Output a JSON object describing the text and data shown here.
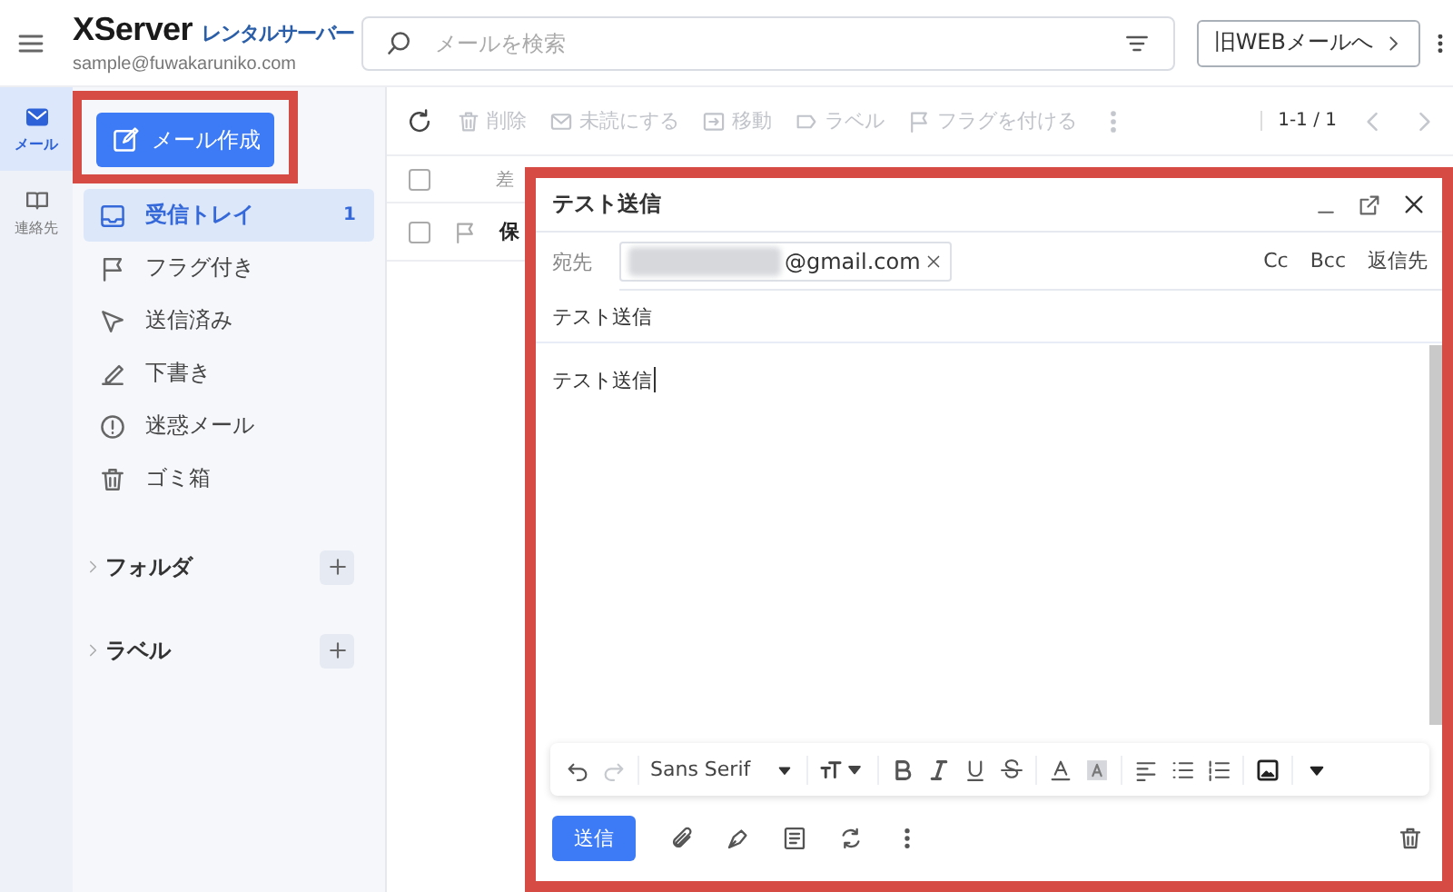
{
  "header": {
    "logo_brand": "XServer",
    "logo_sub": "レンタルサーバー",
    "account": "sample@fuwakaruniko.com",
    "search": {
      "placeholder": "メールを検索"
    },
    "legacy_button": "旧WEBメールへ"
  },
  "rail": [
    {
      "label": "メール",
      "kind": "mail",
      "selected": true
    },
    {
      "label": "連絡先",
      "kind": "contacts",
      "selected": false
    }
  ],
  "compose_button": "メール作成",
  "folders": [
    {
      "label": "受信トレイ",
      "kind": "inbox",
      "selected": true,
      "count": "1"
    },
    {
      "label": "フラグ付き",
      "kind": "flagged",
      "selected": false
    },
    {
      "label": "送信済み",
      "kind": "sent",
      "selected": false
    },
    {
      "label": "下書き",
      "kind": "drafts",
      "selected": false
    },
    {
      "label": "迷惑メール",
      "kind": "spam",
      "selected": false
    },
    {
      "label": "ゴミ箱",
      "kind": "trash",
      "selected": false
    }
  ],
  "sections": [
    {
      "label": "フォルダ",
      "expanded": false
    },
    {
      "label": "ラベル",
      "expanded": false
    }
  ],
  "toolbar": {
    "actions": [
      {
        "label": "削除",
        "kind": "delete",
        "disabled": true
      },
      {
        "label": "未読にする",
        "kind": "unread",
        "disabled": true
      },
      {
        "label": "移動",
        "kind": "move",
        "disabled": true
      },
      {
        "label": "ラベル",
        "kind": "label",
        "disabled": true
      },
      {
        "label": "フラグを付ける",
        "kind": "flag",
        "disabled": true
      }
    ],
    "pagination": "1-1 / 1"
  },
  "list": {
    "column_1": "差",
    "select_all_checked": false,
    "rows": [
      {
        "column_1": "保",
        "checked": false
      }
    ]
  },
  "compose": {
    "title": "テスト送信",
    "to_label": "宛先",
    "recipients": [
      "@gmail.com"
    ],
    "recipient_options": [
      "Cc",
      "Bcc",
      "返信先"
    ],
    "subject": "テスト送信",
    "body": "テスト送信",
    "font": "Sans Serif",
    "send": "送信"
  }
}
